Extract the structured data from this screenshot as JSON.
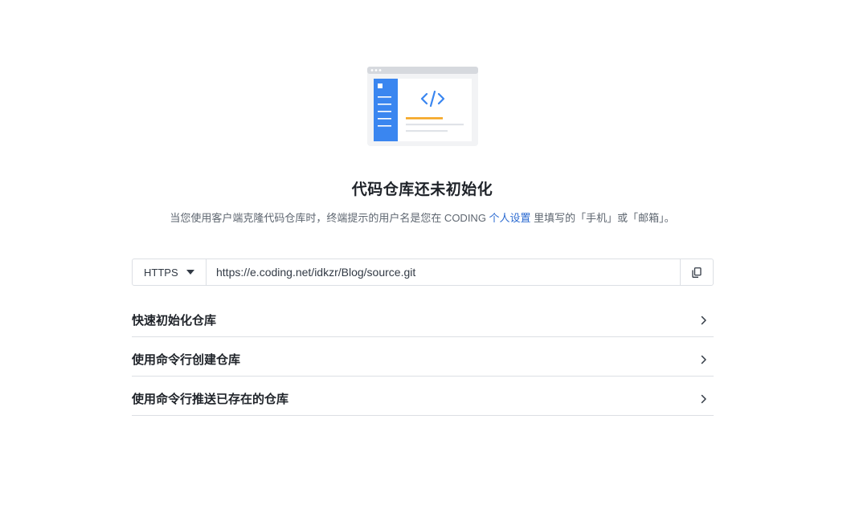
{
  "empty_state": {
    "title": "代码仓库还未初始化",
    "desc_before": "当您使用客户端克隆代码仓库时，终端提示的用户名是您在 CODING ",
    "desc_link": "个人设置",
    "desc_after": " 里填写的「手机」或「邮箱」。"
  },
  "clone": {
    "protocol": "HTTPS",
    "url": "https://e.coding.net/idkzr/Blog/source.git"
  },
  "sections": [
    {
      "label": "快速初始化仓库"
    },
    {
      "label": "使用命令行创建仓库"
    },
    {
      "label": "使用命令行推送已存在的仓库"
    }
  ],
  "icons": {
    "illustration": "code-window-illustration",
    "protocol_dropdown": "caret-down-icon",
    "copy": "copy-icon",
    "section_toggle": "chevron-right-icon"
  },
  "colors": {
    "accent_blue": "#3a86f0",
    "accent_orange": "#f5a623",
    "link": "#2c6bd1",
    "border": "#dcdfe4"
  }
}
